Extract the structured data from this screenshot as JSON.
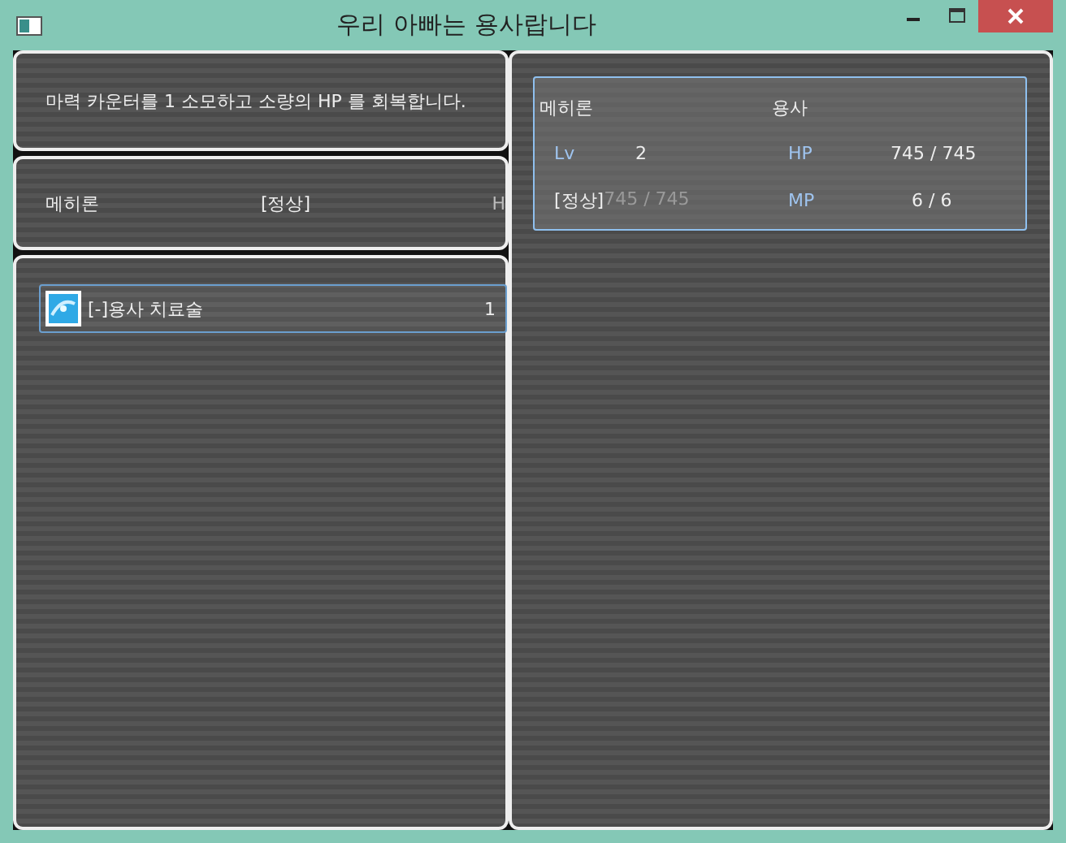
{
  "window": {
    "title": "우리 아빠는 용사랍니다"
  },
  "help": {
    "text": "마력 카운터를 1 소모하고 소량의 HP 를 회복합니다."
  },
  "status": {
    "name": "메히론",
    "state": "[정상]",
    "column_3": "H"
  },
  "skills": [
    {
      "name": "[-]용사 치료술",
      "cost": "1",
      "selected": true
    }
  ],
  "actor": {
    "name": "메히론",
    "class": "용사",
    "lv_label": "Lv",
    "lv_value": "2",
    "hp_label": "HP",
    "hp": "745 / 745",
    "state": "[정상]",
    "faded_text": "745 / 745",
    "mp_label": "MP",
    "mp": "6 / 6"
  }
}
